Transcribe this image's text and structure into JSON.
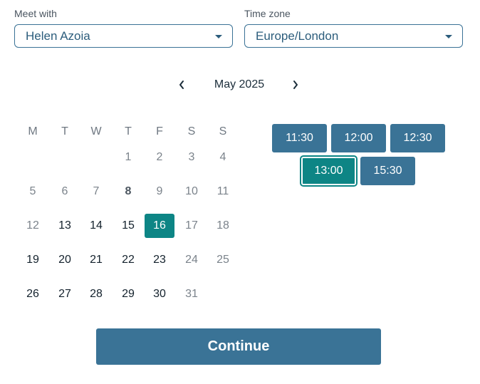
{
  "meet_with": {
    "label": "Meet with",
    "value": "Helen Azoia"
  },
  "time_zone": {
    "label": "Time zone",
    "value": "Europe/London"
  },
  "calendar": {
    "prev_icon": "chevron-left-icon",
    "next_icon": "chevron-right-icon",
    "month_label": "May 2025",
    "weekdays": [
      "M",
      "T",
      "W",
      "T",
      "F",
      "S",
      "S"
    ],
    "weeks": [
      [
        {
          "d": "",
          "state": "empty"
        },
        {
          "d": "",
          "state": "empty"
        },
        {
          "d": "",
          "state": "empty"
        },
        {
          "d": "1",
          "state": "disabled"
        },
        {
          "d": "2",
          "state": "disabled"
        },
        {
          "d": "3",
          "state": "disabled"
        },
        {
          "d": "4",
          "state": "disabled"
        }
      ],
      [
        {
          "d": "5",
          "state": "disabled"
        },
        {
          "d": "6",
          "state": "disabled"
        },
        {
          "d": "7",
          "state": "disabled"
        },
        {
          "d": "8",
          "state": "today"
        },
        {
          "d": "9",
          "state": "disabled"
        },
        {
          "d": "10",
          "state": "disabled"
        },
        {
          "d": "11",
          "state": "disabled"
        }
      ],
      [
        {
          "d": "12",
          "state": "disabled"
        },
        {
          "d": "13",
          "state": "available"
        },
        {
          "d": "14",
          "state": "available"
        },
        {
          "d": "15",
          "state": "available"
        },
        {
          "d": "16",
          "state": "selected"
        },
        {
          "d": "17",
          "state": "disabled"
        },
        {
          "d": "18",
          "state": "disabled"
        }
      ],
      [
        {
          "d": "19",
          "state": "available"
        },
        {
          "d": "20",
          "state": "available"
        },
        {
          "d": "21",
          "state": "available"
        },
        {
          "d": "22",
          "state": "available"
        },
        {
          "d": "23",
          "state": "available"
        },
        {
          "d": "24",
          "state": "disabled"
        },
        {
          "d": "25",
          "state": "disabled"
        }
      ],
      [
        {
          "d": "26",
          "state": "available"
        },
        {
          "d": "27",
          "state": "available"
        },
        {
          "d": "28",
          "state": "available"
        },
        {
          "d": "29",
          "state": "available"
        },
        {
          "d": "30",
          "state": "available"
        },
        {
          "d": "31",
          "state": "disabled"
        },
        {
          "d": "",
          "state": "empty"
        }
      ]
    ]
  },
  "time_slots": [
    {
      "label": "11:30",
      "selected": false
    },
    {
      "label": "12:00",
      "selected": false
    },
    {
      "label": "12:30",
      "selected": false
    },
    {
      "label": "13:00",
      "selected": true
    },
    {
      "label": "15:30",
      "selected": false
    }
  ],
  "continue_label": "Continue",
  "colors": {
    "accent": "#3a7396",
    "selected": "#0d8585",
    "border": "#3a7296"
  }
}
